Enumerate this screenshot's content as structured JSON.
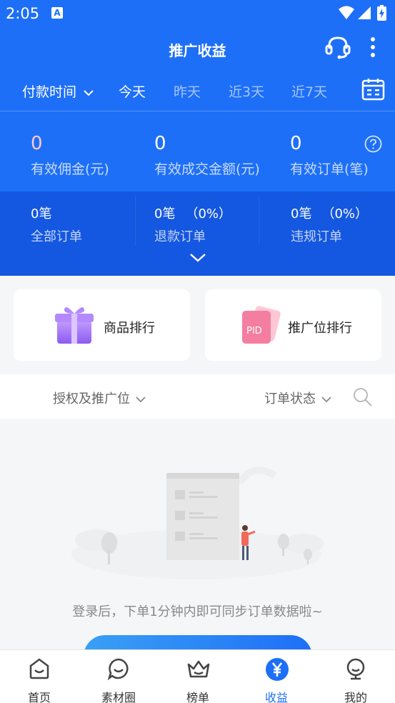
{
  "status_bar": {
    "time": "2:05",
    "notification_icon": "A"
  },
  "header": {
    "title": "推广收益"
  },
  "time_filter": {
    "pay_time": "付款时间",
    "options": [
      "今天",
      "昨天",
      "近3天",
      "近7天"
    ],
    "active": "今天"
  },
  "stats": {
    "commission": {
      "value": "0",
      "label": "有效佣金(元)"
    },
    "amount": {
      "value": "0",
      "label": "有效成交金额(元)"
    },
    "orders": {
      "value": "0",
      "label": "有效订单(笔)"
    }
  },
  "order_stats": {
    "all": {
      "value": "0",
      "unit": "笔",
      "label": "全部订单"
    },
    "refund": {
      "value": "0",
      "unit": "笔",
      "pct": "（0%）",
      "label": "退款订单"
    },
    "violation": {
      "value": "0",
      "unit": "笔",
      "pct": "（0%）",
      "label": "违规订单"
    }
  },
  "cards": {
    "product_rank": "商品排行",
    "position_rank": "推广位排行",
    "pid_text": "PID"
  },
  "filters": {
    "auth_position": "授权及推广位",
    "order_status": "订单状态"
  },
  "empty_state": {
    "message": "登录后，下单1分钟内即可同步订单数据啦~"
  },
  "tabbar": {
    "items": [
      {
        "label": "首页",
        "icon": "home-icon"
      },
      {
        "label": "素材圈",
        "icon": "chat-icon"
      },
      {
        "label": "榜单",
        "icon": "crown-icon"
      },
      {
        "label": "收益",
        "icon": "yen-icon"
      },
      {
        "label": "我的",
        "icon": "profile-icon"
      }
    ],
    "active_index": 3
  },
  "colors": {
    "primary": "#1e6ff7",
    "primary_dark": "#1457e0"
  }
}
